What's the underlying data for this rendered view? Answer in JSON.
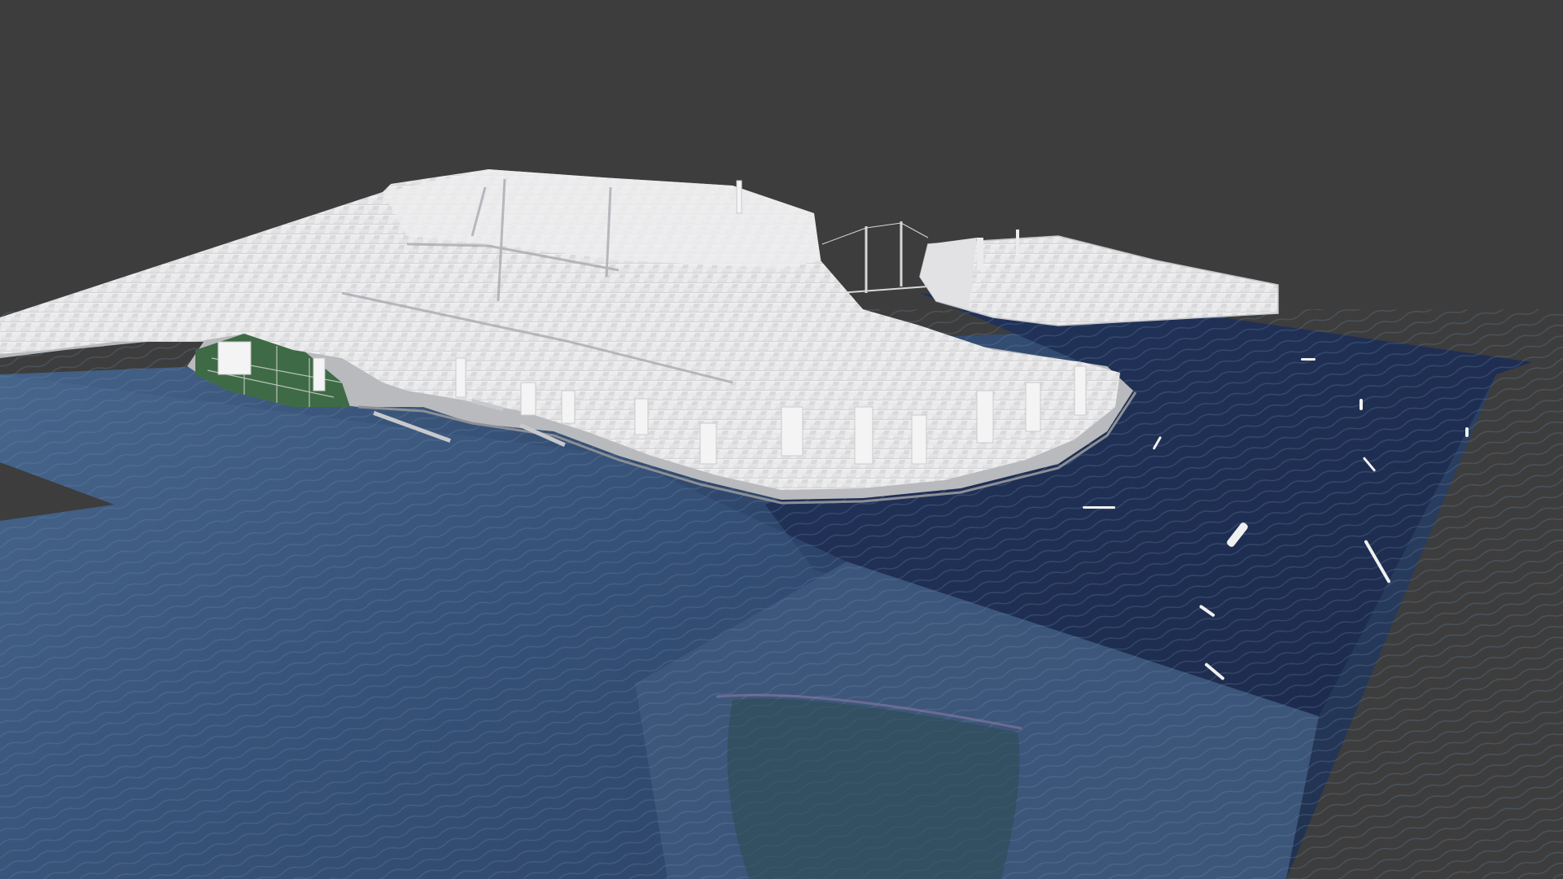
{
  "viewport": {
    "type": "3d-viewport",
    "background_color": "#3d3d3d",
    "ui_text": []
  },
  "scene": {
    "subject": "3d-city-model",
    "ground_texture": "satellite-water-imagery",
    "colors": {
      "water_deep": "#1f2e4c",
      "water_mid": "#2c4268",
      "water_light": "#4b6a8f",
      "buildings": "#e7e7e9",
      "building_shadow": "#c9cacd",
      "park": "#3e6b45",
      "shore": "#b8b8ba"
    }
  }
}
